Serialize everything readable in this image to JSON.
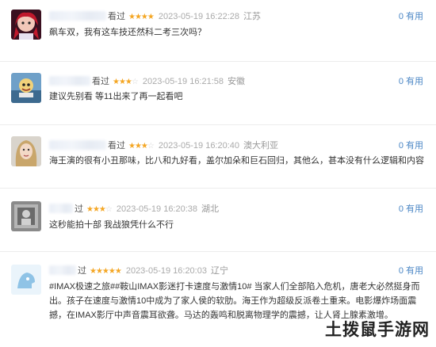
{
  "reviews": [
    {
      "seen": "看过",
      "stars": "★★★★",
      "stars_off": "",
      "time": "2023-05-19 16:22:28",
      "location": "江苏",
      "useful": "0 有用",
      "text": "飙车双，我有这车技还然科二考三次吗？"
    },
    {
      "seen": "看过",
      "stars": "★★★",
      "stars_off": "☆",
      "time": "2023-05-19 16:21:58",
      "location": "安徽",
      "useful": "0 有用",
      "text": "建议先别看 等11出来了再一起看吧"
    },
    {
      "seen": "看过",
      "stars": "★★★",
      "stars_off": "☆",
      "time": "2023-05-19 16:20:40",
      "location": "澳大利亚",
      "useful": "0 有用",
      "text": "海王演的很有小丑那味，比八和九好看，盖尔加朵和巨石回归，其他么，甚本没有什么逻辑和内容"
    },
    {
      "seen": "过",
      "stars": "★★★",
      "stars_off": "☆",
      "time": "2023-05-19 16:20:38",
      "location": "湖北",
      "useful": "0 有用",
      "text": "这秒能拍十部 我战狼凭什么不行"
    },
    {
      "seen": "过",
      "stars": "★★★★★",
      "stars_off": "",
      "time": "2023-05-19 16:20:03",
      "location": "辽宁",
      "useful": "0 有用",
      "text": "#IMAX极速之旅##鞍山IMAX影迷打卡速度与激情10# 当家人们全部陷入危机，唐老大必然挺身而出。孩子在速度与激情10中成为了家人侯的软肋。海王作为超级反派卷土重来。电影爆炸场面震撼，在IMAX影厅中声音震耳欲聋。马达的轰鸣和脱离物理学的震撼，让人肾上腺素激增。"
    }
  ],
  "watermark": "土拨鼠手游网"
}
